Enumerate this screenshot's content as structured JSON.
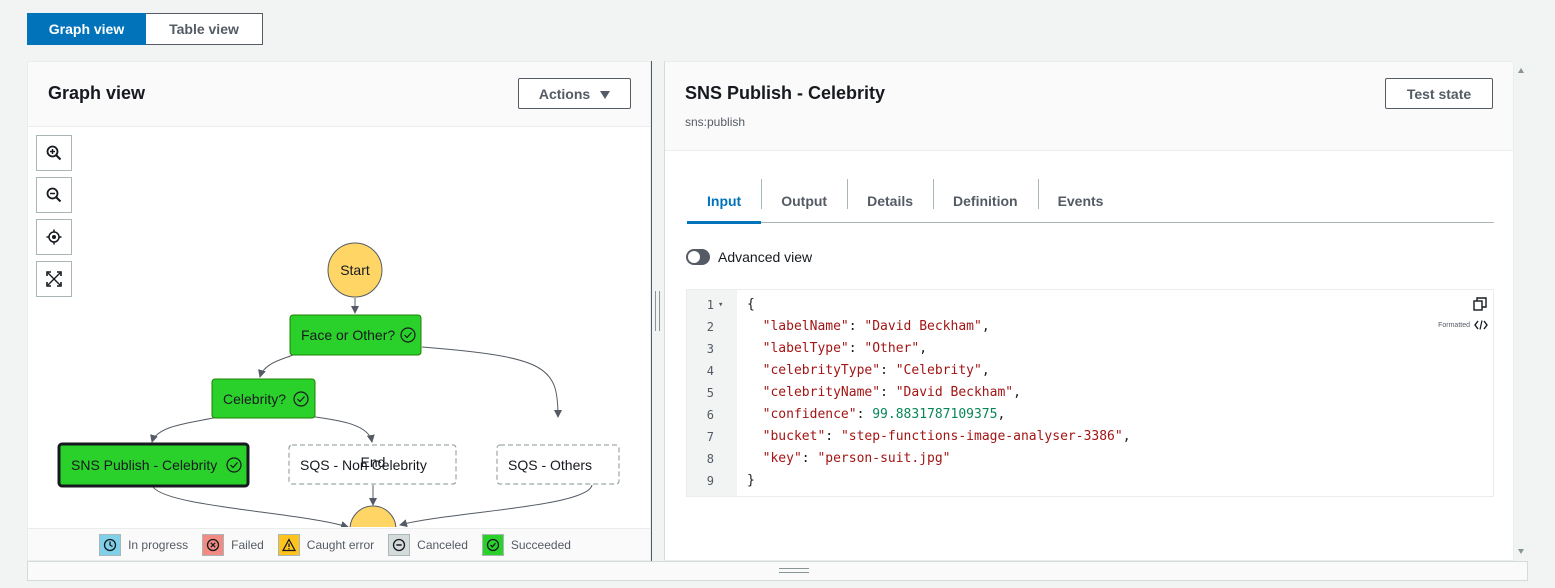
{
  "view_toggle": {
    "graph": "Graph view",
    "table": "Table view"
  },
  "graph_panel": {
    "title": "Graph view",
    "actions_label": "Actions",
    "zoom_controls": [
      "zoom-in-icon",
      "zoom-out-icon",
      "center-icon",
      "fit-icon"
    ],
    "nodes": {
      "start": "Start",
      "face_or_other": "Face or Other?",
      "celebrity": "Celebrity?",
      "sns_publish": "SNS Publish - Celebrity",
      "sqs_non_celebrity": "SQS - Non Celebrity",
      "sqs_others": "SQS - Others",
      "end": "End"
    },
    "legend": [
      {
        "label": "In progress",
        "color": "#7fd0e8",
        "icon": "clock-icon"
      },
      {
        "label": "Failed",
        "color": "#f28b82",
        "icon": "x-icon"
      },
      {
        "label": "Caught error",
        "color": "#ffc31f",
        "icon": "warning-icon"
      },
      {
        "label": "Canceled",
        "color": "#d5dbdb",
        "icon": "minus-icon"
      },
      {
        "label": "Succeeded",
        "color": "#2bd12b",
        "icon": "check-icon"
      }
    ],
    "colors": {
      "success": "#2bd12b",
      "terminal": "#ffd666",
      "accent": "#0073bb"
    }
  },
  "details_panel": {
    "title": "SNS Publish - Celebrity",
    "subtitle": "sns:publish",
    "test_state_label": "Test state",
    "tabs": [
      "Input",
      "Output",
      "Details",
      "Definition",
      "Events"
    ],
    "active_tab": "Input",
    "advanced_view_label": "Advanced view",
    "formatted_label": "Formatted",
    "code_lines": [
      {
        "n": "1",
        "text": "{"
      },
      {
        "n": "2",
        "key": "\"labelName\"",
        "val": "\"David Beckham\"",
        "kind": "s",
        "comma": ","
      },
      {
        "n": "3",
        "key": "\"labelType\"",
        "val": "\"Other\"",
        "kind": "s",
        "comma": ","
      },
      {
        "n": "4",
        "key": "\"celebrityType\"",
        "val": "\"Celebrity\"",
        "kind": "s",
        "comma": ","
      },
      {
        "n": "5",
        "key": "\"celebrityName\"",
        "val": "\"David Beckham\"",
        "kind": "s",
        "comma": ","
      },
      {
        "n": "6",
        "key": "\"confidence\"",
        "val": "99.8831787109375",
        "kind": "n",
        "comma": ","
      },
      {
        "n": "7",
        "key": "\"bucket\"",
        "val": "\"step-functions-image-analyser-3386\"",
        "kind": "s",
        "comma": ","
      },
      {
        "n": "8",
        "key": "\"key\"",
        "val": "\"person-suit.jpg\"",
        "kind": "s",
        "comma": ""
      },
      {
        "n": "9",
        "text": "}"
      }
    ]
  }
}
